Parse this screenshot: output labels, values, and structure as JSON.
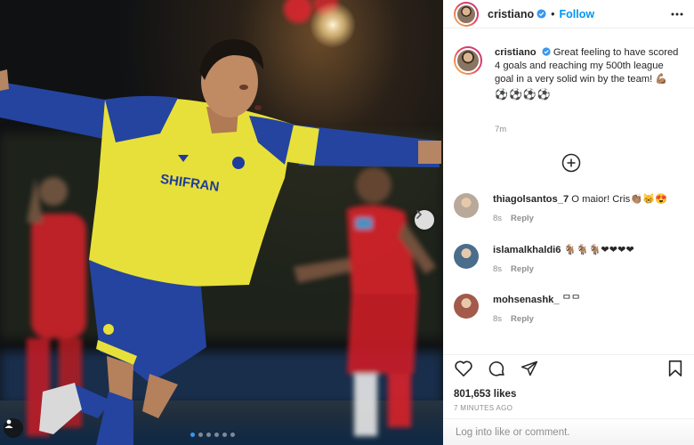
{
  "post": {
    "username": "cristiano",
    "follow_label": "Follow",
    "bullet": "•",
    "caption": {
      "username": "cristiano",
      "text": "Great feeling to have scored 4 goals and reaching my 500th league goal in a very solid win by the team! 💪🏽",
      "emoji_line": "⚽⚽⚽⚽",
      "time": "7m"
    },
    "comments": [
      {
        "username": "thiagolsantos_7",
        "text": "O maior! Cris👏🏽😸😍",
        "time": "8s",
        "reply": "Reply",
        "avatar_color": "#b8a99a"
      },
      {
        "username": "islamalkhaldi6",
        "text": "🐐🐐🐐❤❤❤❤",
        "time": "8s",
        "reply": "Reply",
        "avatar_color": "#4a6d8c"
      },
      {
        "username": "mohsenashk_",
        "text": "ᄆᄆ",
        "time": "8s",
        "reply": "Reply",
        "avatar_color": "#a35a4a"
      }
    ],
    "likes": "801,653 likes",
    "time_ago": "7 MINUTES AGO",
    "login_prompt": {
      "link_text": "Log in",
      "rest_text": " to like or comment."
    }
  },
  "media": {
    "jersey_sponsor": "SHIFRAN",
    "carousel": {
      "count": 6,
      "active_index": 0
    }
  },
  "colors": {
    "follow_blue": "#0095f6",
    "verified_blue": "#3897f0",
    "jersey_yellow": "#e8e03a",
    "jersey_blue": "#1f3c9c",
    "opponent_red": "#d8232a"
  },
  "icons": {
    "header_more": "more-dots-icon",
    "load_more": "plus-circle-icon",
    "like": "heart-icon",
    "comment": "comment-bubble-icon",
    "share": "paper-plane-icon",
    "save": "bookmark-icon",
    "carousel_next": "chevron-right-icon",
    "tag": "user-tag-icon"
  }
}
